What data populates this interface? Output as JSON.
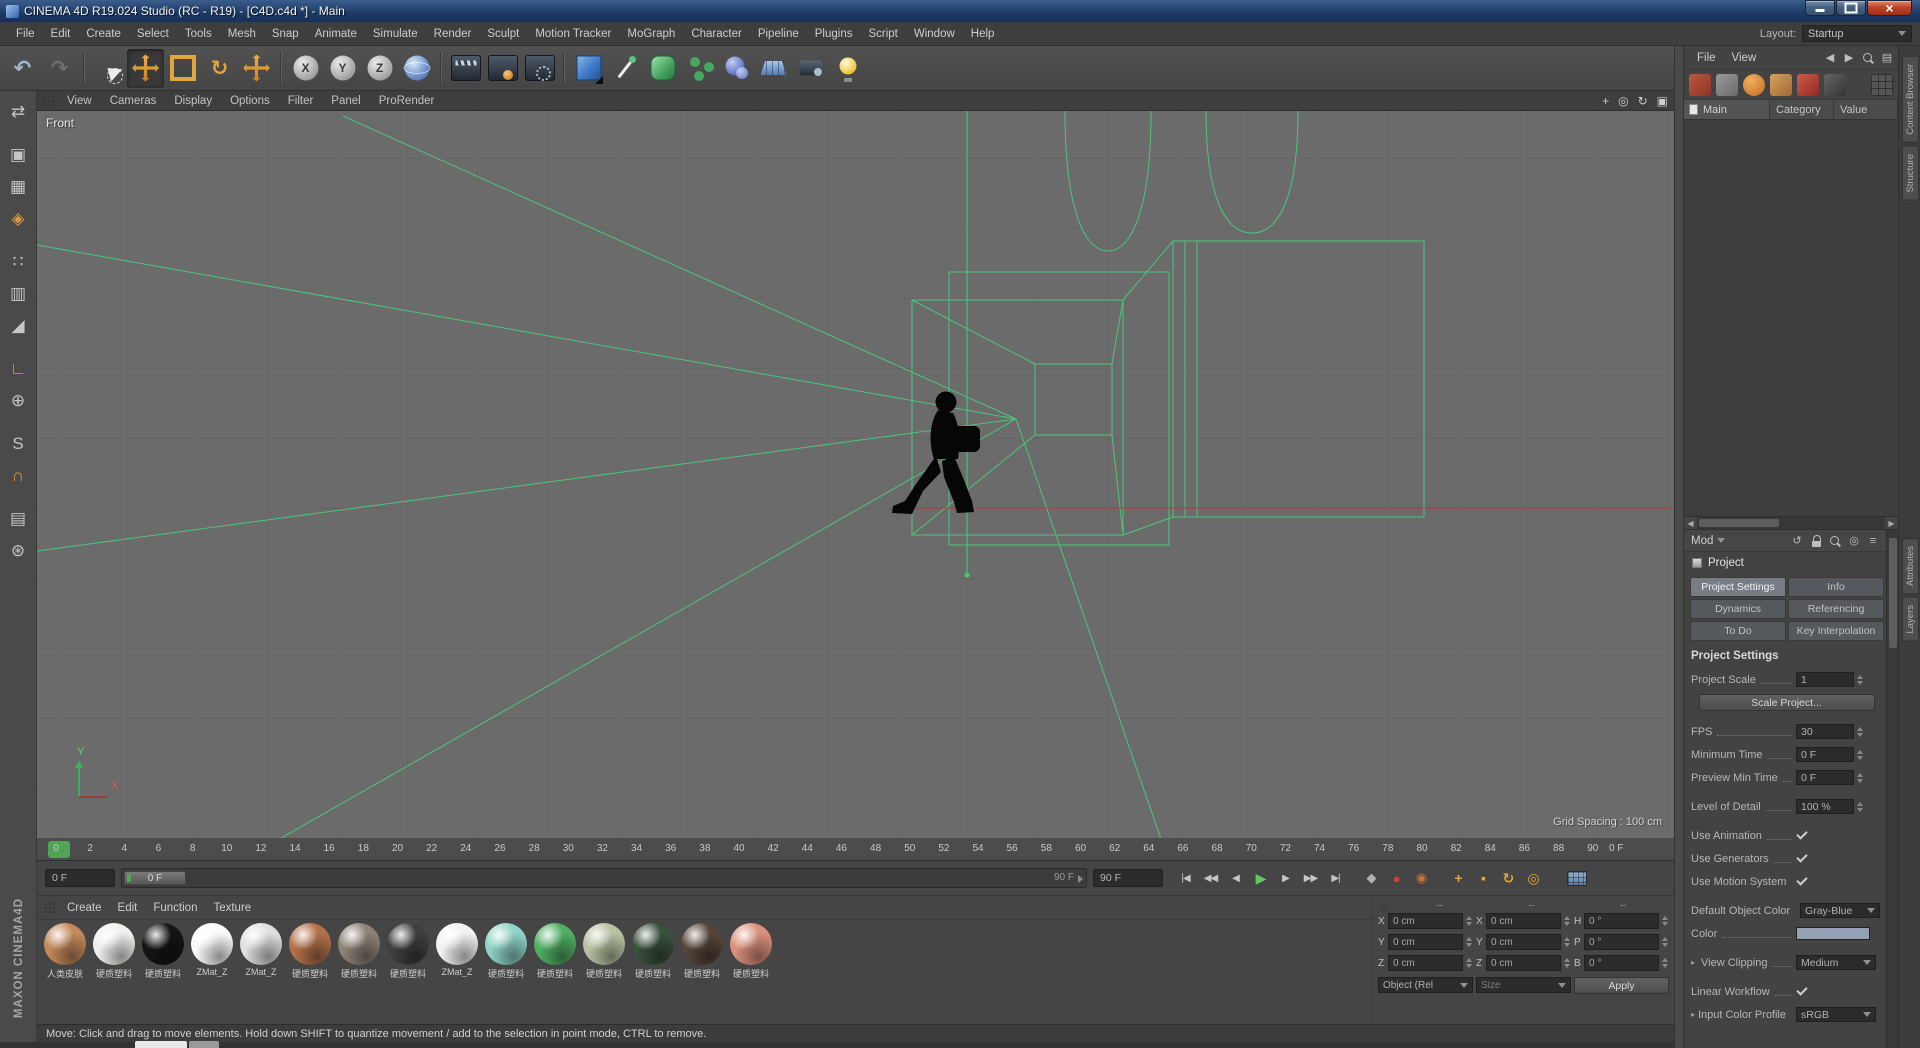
{
  "window": {
    "title": "CINEMA 4D R19.024 Studio (RC - R19) - [C4D.c4d *] - Main",
    "controls": [
      "minimize",
      "maximize",
      "close"
    ]
  },
  "menubar": {
    "items": [
      "File",
      "Edit",
      "Create",
      "Select",
      "Tools",
      "Mesh",
      "Snap",
      "Animate",
      "Simulate",
      "Render",
      "Sculpt",
      "Motion Tracker",
      "MoGraph",
      "Character",
      "Pipeline",
      "Plugins",
      "Script",
      "Window",
      "Help"
    ],
    "layout_label": "Layout:",
    "layout_value": "Startup"
  },
  "toolbar": {
    "groups": [
      [
        {
          "name": "undo-icon",
          "type": "glyph",
          "glyph": "↶",
          "color": "#9fb9cf"
        },
        {
          "name": "redo-icon",
          "type": "glyph",
          "glyph": "↷",
          "color": "#6e6e6e"
        }
      ],
      [
        {
          "name": "live-selection-icon",
          "type": "selection"
        },
        {
          "name": "move-tool-icon",
          "type": "move",
          "active": true
        },
        {
          "name": "scale-tool-icon",
          "type": "scale"
        },
        {
          "name": "rotate-tool-icon",
          "type": "glyph",
          "glyph": "↻",
          "color": "#e2a63e"
        },
        {
          "name": "last-tool-icon",
          "type": "move"
        }
      ],
      [
        {
          "name": "lock-x-icon",
          "type": "lock",
          "letter": "X"
        },
        {
          "name": "lock-y-icon",
          "type": "lock",
          "letter": "Y"
        },
        {
          "name": "lock-z-icon",
          "type": "lock",
          "letter": "Z"
        },
        {
          "name": "coordinate-system-icon",
          "type": "globe"
        }
      ],
      [
        {
          "name": "render-view-icon",
          "type": "clapper"
        },
        {
          "name": "render-picture-viewer-icon",
          "type": "clapper2"
        },
        {
          "name": "render-settings-icon",
          "type": "clapper3"
        }
      ],
      [
        {
          "name": "add-cube-icon",
          "type": "cube"
        },
        {
          "name": "freehand-spline-icon",
          "type": "pen"
        },
        {
          "name": "subdivision-surface-icon",
          "type": "sds"
        },
        {
          "name": "array-icon",
          "type": "array"
        },
        {
          "name": "metaball-icon",
          "type": "metaball"
        },
        {
          "name": "floor-icon",
          "type": "floor"
        },
        {
          "name": "camera-icon",
          "type": "camera"
        },
        {
          "name": "light-icon",
          "type": "light"
        }
      ]
    ]
  },
  "palette": {
    "icons": [
      {
        "name": "make-editable-icon",
        "glyph": "⇄"
      },
      {
        "name": "model-mode-icon",
        "glyph": "▣",
        "gap": true
      },
      {
        "name": "texture-mode-icon",
        "glyph": "▦"
      },
      {
        "name": "workplane-mode-icon",
        "glyph": "◈",
        "color": "#d89a45"
      },
      {
        "name": "points-mode-icon",
        "glyph": "∷",
        "gap": true
      },
      {
        "name": "edges-mode-icon",
        "glyph": "▥"
      },
      {
        "name": "polygons-mode-icon",
        "glyph": "◢"
      },
      {
        "name": "axis-mode-icon",
        "glyph": "∟",
        "color": "#d89a45",
        "gap": true
      },
      {
        "name": "enable-axis-icon",
        "glyph": "⊕"
      },
      {
        "name": "snap-icon",
        "glyph": "S",
        "gap": true
      },
      {
        "name": "magnet-icon",
        "glyph": "∩",
        "color": "#d89a45"
      },
      {
        "name": "workplane-lock-icon",
        "glyph": "▤",
        "gap": true
      },
      {
        "name": "gear-icon",
        "glyph": "⊛"
      }
    ]
  },
  "viewport": {
    "menu": [
      "View",
      "Cameras",
      "Display",
      "Options",
      "Filter",
      "Panel",
      "ProRender"
    ],
    "corner_icons": [
      {
        "name": "pan-view-icon",
        "glyph": "+"
      },
      {
        "name": "zoom-view-icon",
        "glyph": "◎"
      },
      {
        "name": "rotate-view-icon",
        "glyph": "↻"
      },
      {
        "name": "toggle-view-icon",
        "glyph": "▣"
      }
    ],
    "view_label": "Front",
    "grid_spacing_label": "Grid Spacing : 100 cm",
    "axis_x": "X",
    "axis_y": "Y"
  },
  "timeline": {
    "ticks": [
      "0",
      "2",
      "4",
      "6",
      "8",
      "10",
      "12",
      "14",
      "16",
      "18",
      "20",
      "22",
      "24",
      "26",
      "28",
      "30",
      "32",
      "34",
      "36",
      "38",
      "40",
      "42",
      "44",
      "46",
      "48",
      "50",
      "52",
      "54",
      "56",
      "58",
      "60",
      "62",
      "64",
      "66",
      "68",
      "70",
      "72",
      "74",
      "76",
      "78",
      "80",
      "82",
      "84",
      "86",
      "88",
      "90"
    ],
    "ruler_right_label": "0 F",
    "current_frame_field": "0 F",
    "slider_handle_label": "0 F",
    "slider_end_label": "90 F",
    "end_frame_field": "90 F",
    "playback": [
      {
        "name": "goto-start-button",
        "glyph": "|◀"
      },
      {
        "name": "prev-key-button",
        "glyph": "◀◀"
      },
      {
        "name": "prev-frame-button",
        "glyph": "◀"
      },
      {
        "name": "play-button",
        "glyph": "▶",
        "cls": "play"
      },
      {
        "name": "next-frame-button",
        "glyph": "▶"
      },
      {
        "name": "next-key-button",
        "glyph": "▶▶"
      },
      {
        "name": "goto-end-button",
        "glyph": "▶|"
      }
    ],
    "record_icons": [
      {
        "name": "keyframe-button",
        "glyph": "◆",
        "color": "#b0b0b0"
      },
      {
        "name": "record-button",
        "glyph": "●",
        "color": "#c8453a"
      },
      {
        "name": "autokey-button",
        "glyph": "◉",
        "color": "#cc7038"
      }
    ],
    "key_toggles": [
      {
        "name": "key-position-toggle",
        "glyph": "+",
        "color": "#e2a63e"
      },
      {
        "name": "key-scale-toggle",
        "glyph": "▪",
        "color": "#e2a63e"
      },
      {
        "name": "key-rotation-toggle",
        "glyph": "↻",
        "color": "#e2a63e"
      },
      {
        "name": "key-parameter-toggle",
        "glyph": "◎",
        "color": "#e2a63e"
      }
    ]
  },
  "materials": {
    "menu": [
      "Create",
      "Edit",
      "Function",
      "Texture"
    ],
    "items": [
      {
        "label": "人类皮肤",
        "color": "#c4895a"
      },
      {
        "label": "硬质塑料",
        "color": "#f0f0ee"
      },
      {
        "label": "硬质塑料",
        "color": "#141414"
      },
      {
        "label": "ZMat_Z",
        "color": "#fafafa"
      },
      {
        "label": "ZMat_Z",
        "color": "#e0e0e0"
      },
      {
        "label": "硬质塑料",
        "color": "#b3714a"
      },
      {
        "label": "硬质塑料",
        "color": "#8d8276"
      },
      {
        "label": "硬质塑料",
        "color": "#3f3f3f"
      },
      {
        "label": "ZMat_Z",
        "color": "#f2f2f2"
      },
      {
        "label": "硬质塑料",
        "color": "#8ed4c6"
      },
      {
        "label": "硬质塑料",
        "color": "#4fae63"
      },
      {
        "label": "硬质塑料",
        "color": "#b7c2a2"
      },
      {
        "label": "硬质塑料",
        "color": "#39503c"
      },
      {
        "label": "硬质塑料",
        "color": "#564439"
      },
      {
        "label": "硬质塑料",
        "color": "#d9907c"
      }
    ]
  },
  "coordinates": {
    "header_dashes": [
      "--",
      "--",
      "--"
    ],
    "columns": [
      {
        "rows": [
          {
            "label": "X",
            "value": "0 cm"
          },
          {
            "label": "Y",
            "value": "0 cm"
          },
          {
            "label": "Z",
            "value": "0 cm"
          }
        ],
        "footer": {
          "type": "dropdown",
          "value": "Object (Rel"
        }
      },
      {
        "rows": [
          {
            "label": "X",
            "value": "0 cm"
          },
          {
            "label": "Y",
            "value": "0 cm"
          },
          {
            "label": "Z",
            "value": "0 cm"
          }
        ],
        "footer": {
          "type": "dropdown",
          "value": "Size",
          "dim": true
        }
      },
      {
        "rows": [
          {
            "label": "H",
            "value": "0 °"
          },
          {
            "label": "P",
            "value": "0 °"
          },
          {
            "label": "B",
            "value": "0 °"
          }
        ],
        "footer": {
          "type": "button",
          "value": "Apply"
        }
      }
    ]
  },
  "browser": {
    "menus": [
      "File",
      "View"
    ],
    "nav_icons": [
      {
        "name": "back-icon",
        "glyph": "◀"
      },
      {
        "name": "forward-icon",
        "glyph": "▶"
      },
      {
        "name": "search-icon",
        "css": "mini-search"
      },
      {
        "name": "panel-menu-icon",
        "glyph": "▤"
      }
    ],
    "toolbar_icons": [
      {
        "name": "catalog-icon",
        "cls": "bi1"
      },
      {
        "name": "computer-icon",
        "cls": "bi2"
      },
      {
        "name": "presets-icon",
        "cls": "bi3"
      },
      {
        "name": "materials-icon",
        "cls": "bi4"
      },
      {
        "name": "shaders-icon",
        "cls": "bi5"
      },
      {
        "name": "textures-icon",
        "cls": "bi6"
      },
      {
        "name": "thumbnails-icon",
        "cls": "bi7",
        "right": true
      }
    ],
    "tab_label": "Main",
    "columns": [
      "Category",
      "Value"
    ],
    "side_tabs": [
      "Content Browser",
      "Structure"
    ]
  },
  "attributes": {
    "mode_label": "Mod",
    "header_icons": [
      {
        "name": "history-icon",
        "glyph": "↺"
      },
      {
        "name": "lock-icon",
        "css": "mini-lock"
      },
      {
        "name": "search-icon",
        "css": "mini-search"
      },
      {
        "name": "target-icon",
        "glyph": "◎"
      },
      {
        "name": "panel-menu-icon",
        "glyph": "≡"
      }
    ],
    "object_label": "Project",
    "tabs": [
      {
        "label": "Project Settings",
        "active": true
      },
      {
        "label": "Info"
      },
      {
        "label": "Dynamics"
      },
      {
        "label": "Referencing"
      },
      {
        "label": "To Do"
      },
      {
        "label": "Key Interpolation"
      }
    ],
    "section_title": "Project Settings",
    "rows": [
      {
        "label": "Project Scale",
        "type": "spin",
        "value": "1"
      },
      {
        "type": "button",
        "value": "Scale Project..."
      },
      {
        "label": "FPS",
        "type": "spin",
        "value": "30",
        "gap": true
      },
      {
        "label": "Minimum Time",
        "type": "spin",
        "value": "0 F"
      },
      {
        "label": "Preview Min Time",
        "type": "spin",
        "value": "0 F"
      },
      {
        "label": "Level of Detail",
        "type": "spin",
        "value": "100 %",
        "gap": true
      },
      {
        "label": "Use Animation",
        "type": "check",
        "checked": true,
        "gap": true
      },
      {
        "label": "Use Generators",
        "type": "check",
        "checked": true
      },
      {
        "label": "Use Motion System",
        "type": "check",
        "checked": true
      },
      {
        "label": "Default Object Color",
        "type": "dropdown",
        "value": "Gray-Blue",
        "gap": true
      },
      {
        "label": "Color",
        "type": "swatch",
        "value": "#96a0b4"
      },
      {
        "label": "View Clipping",
        "type": "dropdown",
        "value": "Medium",
        "expander": true,
        "gap": true
      },
      {
        "label": "Linear Workflow",
        "type": "check",
        "checked": true,
        "gap": true
      },
      {
        "label": "Input Color Profile",
        "type": "dropdown",
        "value": "sRGB",
        "expander": true
      }
    ],
    "side_tabs": [
      "Attributes",
      "Layers"
    ]
  },
  "statusbar": {
    "text": "Move: Click and drag to move elements. Hold down SHIFT to quantize movement / add to the selection in point mode, CTRL to remove."
  },
  "branding": {
    "vertical_text": "MAXON CINEMA4D"
  }
}
